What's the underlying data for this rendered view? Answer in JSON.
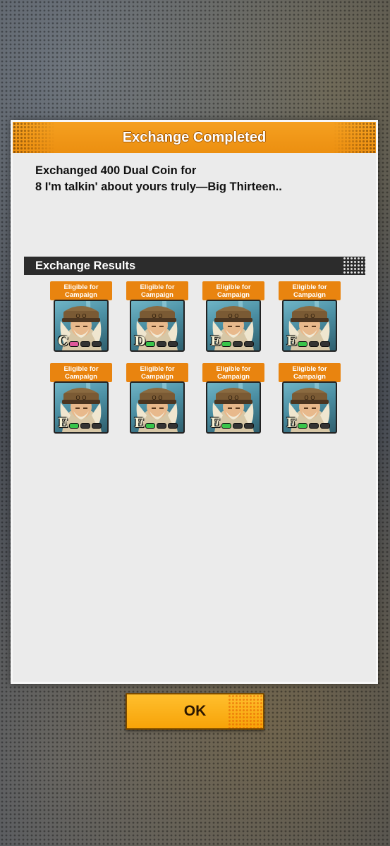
{
  "modal": {
    "title": "Exchange Completed",
    "message_line1": "Exchanged 400 Dual Coin for",
    "message_line2": "8 I'm talkin' about yours truly—Big Thirteen..",
    "results_header": "Exchange Results"
  },
  "results": [
    {
      "badge_line1": "Eligible for",
      "badge_line2": "Campaign",
      "rank": "C",
      "pip": "pink"
    },
    {
      "badge_line1": "Eligible for",
      "badge_line2": "Campaign",
      "rank": "D",
      "pip": "green"
    },
    {
      "badge_line1": "Eligible for",
      "badge_line2": "Campaign",
      "rank": "E",
      "pip": "green"
    },
    {
      "badge_line1": "Eligible for",
      "badge_line2": "Campaign",
      "rank": "E",
      "pip": "green"
    },
    {
      "badge_line1": "Eligible for",
      "badge_line2": "Campaign",
      "rank": "E",
      "pip": "green"
    },
    {
      "badge_line1": "Eligible for",
      "badge_line2": "Campaign",
      "rank": "E",
      "pip": "green"
    },
    {
      "badge_line1": "Eligible for",
      "badge_line2": "Campaign",
      "rank": "E",
      "pip": "green"
    },
    {
      "badge_line1": "Eligible for",
      "badge_line2": "Campaign",
      "rank": "E",
      "pip": "green"
    }
  ],
  "ok_label": "OK",
  "colors": {
    "accent": "#f0961a",
    "badge": "#e9840f",
    "results_bar": "#2c2c2c",
    "panel": "#ebebeb"
  }
}
